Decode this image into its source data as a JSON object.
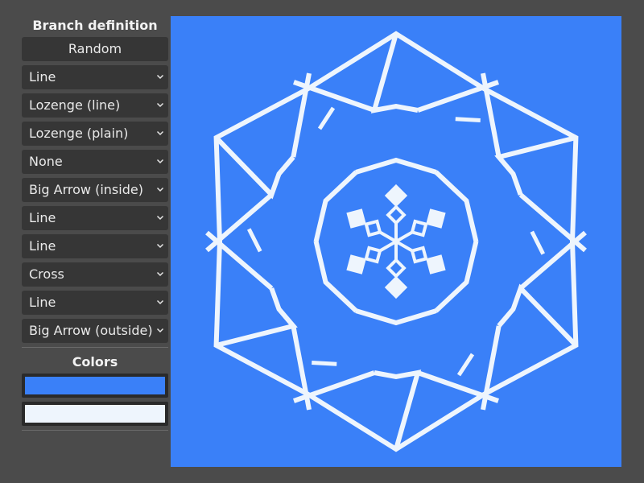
{
  "sidebar": {
    "branch_title": "Branch definition",
    "random_label": "Random",
    "dropdowns": [
      "Line",
      "Lozenge (line)",
      "Lozenge (plain)",
      "None",
      "Big Arrow (inside)",
      "Line",
      "Line",
      "Cross",
      "Line",
      "Big Arrow (outside)"
    ],
    "colors_title": "Colors",
    "colors": {
      "background": "#3a80f8",
      "foreground": "#eef5fd"
    }
  },
  "icons": {
    "dropdown_arrow": "chevron-down-icon"
  },
  "canvas": {
    "shape": "snowflake",
    "background_color": "#3a80f8",
    "line_color": "#eef5fd"
  }
}
